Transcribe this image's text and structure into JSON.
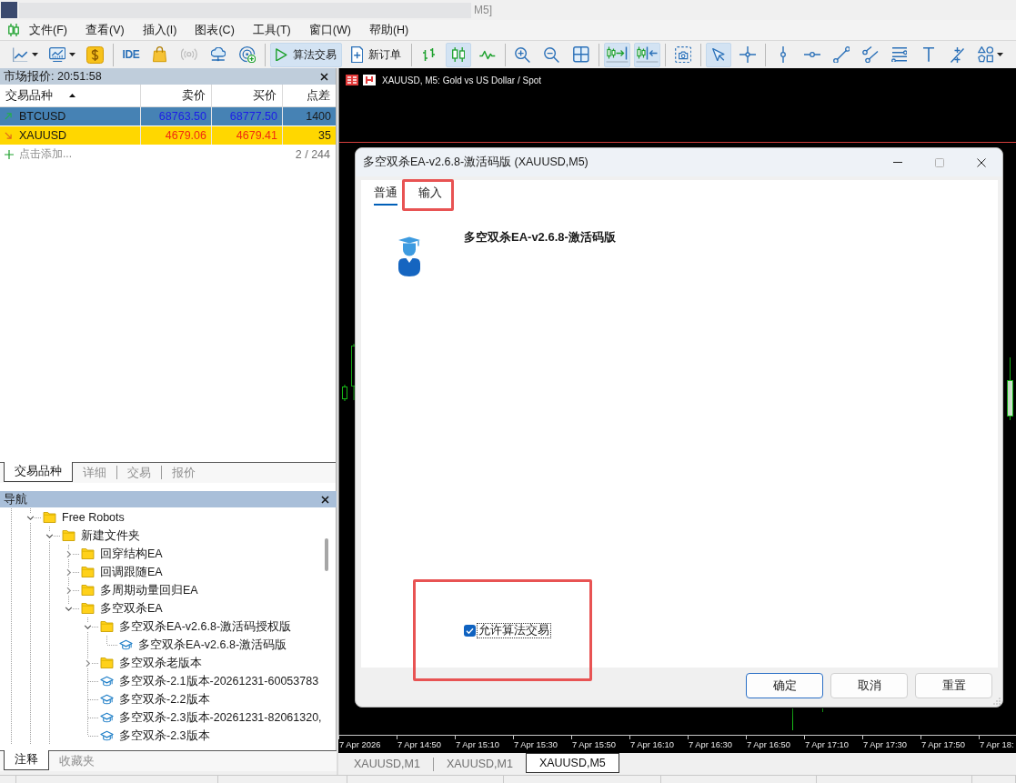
{
  "window": {
    "title": "M5]"
  },
  "menu": {
    "items": [
      "文件(F)",
      "查看(V)",
      "插入(I)",
      "图表(C)",
      "工具(T)",
      "窗口(W)",
      "帮助(H)"
    ]
  },
  "toolbar": {
    "groups": [
      [
        {
          "selected": false,
          "disabled": false
        },
        {
          "selected": false,
          "disabled": false
        },
        {
          "selected": false,
          "disabled": false
        }
      ],
      [
        {
          "label": "IDE",
          "selected": false,
          "disabled": false
        },
        {
          "selected": false,
          "disabled": false
        },
        {
          "selected": false,
          "disabled": true
        },
        {
          "selected": false,
          "disabled": false
        },
        {
          "selected": false,
          "disabled": false
        }
      ],
      [
        {
          "label": "算法交易",
          "selected": true,
          "disabled": false
        },
        {
          "label": "新订单",
          "selected": false,
          "disabled": false
        }
      ],
      [
        {
          "selected": false,
          "disabled": false
        },
        {
          "selected": true,
          "disabled": false
        },
        {
          "selected": false,
          "disabled": false
        }
      ],
      [
        {
          "selected": false,
          "disabled": false
        },
        {
          "selected": false,
          "disabled": false
        },
        {
          "selected": false,
          "disabled": false
        }
      ],
      [
        {
          "selected": true,
          "disabled": false
        },
        {
          "selected": true,
          "disabled": false
        }
      ],
      [
        {
          "selected": false,
          "disabled": false
        }
      ],
      [
        {
          "selected": true,
          "disabled": false
        },
        {
          "selected": false,
          "disabled": false
        }
      ],
      [
        {
          "selected": false,
          "disabled": false
        },
        {
          "selected": false,
          "disabled": false
        },
        {
          "selected": false,
          "disabled": false
        },
        {
          "selected": false,
          "disabled": false
        },
        {
          "selected": false,
          "disabled": false
        },
        {
          "selected": false,
          "disabled": false
        },
        {
          "selected": false,
          "disabled": false
        },
        {
          "selected": false,
          "disabled": false
        }
      ]
    ]
  },
  "market_watch": {
    "title": "市场报价: 20:51:58",
    "active": false,
    "columns": [
      {
        "label": "交易品种",
        "sorted": true
      },
      {
        "label": "卖价",
        "sorted": false
      },
      {
        "label": "买价",
        "sorted": false
      },
      {
        "label": "点差",
        "sorted": false
      }
    ],
    "rows": [
      {
        "symbol": "BTCUSD",
        "bid": "68763.50",
        "ask": "68777.50",
        "spread": "1400",
        "kind": "up",
        "color": "#4682b4"
      },
      {
        "symbol": "XAUUSD",
        "bid": "4679.06",
        "ask": "4679.41",
        "spread": "35",
        "kind": "down",
        "color": "#ffd700"
      }
    ],
    "add_label": "点击添加...",
    "count": "2 / 244",
    "tabs": [
      {
        "label": "交易品种",
        "selected": true
      },
      {
        "label": "详细",
        "selected": false
      },
      {
        "label": "交易",
        "selected": false
      },
      {
        "label": "报价",
        "selected": false
      }
    ]
  },
  "navigator": {
    "title": "导航",
    "active": true,
    "tree": [
      {
        "label": "Free Robots",
        "kind": "folder",
        "expanded": true,
        "children": [
          {
            "label": "新建文件夹",
            "kind": "folder",
            "expanded": true,
            "children": [
              {
                "label": "回穿结构EA",
                "kind": "folder",
                "expanded": false
              },
              {
                "label": "回调跟随EA",
                "kind": "folder",
                "expanded": false
              },
              {
                "label": "多周期动量回归EA",
                "kind": "folder",
                "expanded": false
              },
              {
                "label": "多空双杀EA",
                "kind": "folder",
                "expanded": true,
                "children": [
                  {
                    "label": "多空双杀EA-v2.6.8-激活码授权版",
                    "kind": "folder",
                    "expanded": true,
                    "children": [
                      {
                        "label": "多空双杀EA-v2.6.8-激活码版",
                        "kind": "expert"
                      }
                    ]
                  },
                  {
                    "label": "多空双杀老版本",
                    "kind": "folder",
                    "expanded": false
                  },
                  {
                    "label": "多空双杀-2.1版本-20261231-60053783",
                    "kind": "expert"
                  },
                  {
                    "label": "多空双杀-2.2版本",
                    "kind": "expert"
                  },
                  {
                    "label": "多空双杀-2.3版本-20261231-82061320,",
                    "kind": "expert"
                  },
                  {
                    "label": "多空双杀-2.3版本",
                    "kind": "expert"
                  }
                ]
              }
            ]
          }
        ]
      }
    ],
    "tabs": [
      {
        "label": "注释",
        "selected": true
      },
      {
        "label": "收藏夹",
        "selected": false
      }
    ]
  },
  "chart": {
    "title": "XAUUSD, M5: Gold vs US Dollar / Spot",
    "time_axis": [
      "7 Apr 2026",
      "7 Apr 14:50",
      "7 Apr 15:10",
      "7 Apr 15:30",
      "7 Apr 15:50",
      "7 Apr 16:10",
      "7 Apr 16:30",
      "7 Apr 16:50",
      "7 Apr 17:10",
      "7 Apr 17:30",
      "7 Apr 17:50",
      "7 Apr 18:"
    ],
    "tabs": [
      {
        "label": "XAUUSD,M1",
        "selected": false
      },
      {
        "label": "XAUUSD,M1",
        "selected": false
      },
      {
        "label": "XAUUSD,M5",
        "selected": true
      }
    ]
  },
  "dialog": {
    "title": "多空双杀EA-v2.6.8-激活码版 (XAUUSD,M5)",
    "controls": [
      {
        "kind": "minimize",
        "disabled": false
      },
      {
        "kind": "maximize",
        "disabled": true
      },
      {
        "kind": "close",
        "disabled": false
      }
    ],
    "tabs": [
      {
        "label": "普通",
        "selected": true,
        "highlighted": false
      },
      {
        "label": "输入",
        "selected": false,
        "highlighted": true
      }
    ],
    "expert_name": "多空双杀EA-v2.6.8-激活码版",
    "options": [
      {
        "label": "允许算法交易",
        "checked": true,
        "focused": true,
        "highlighted": true
      }
    ],
    "buttons": [
      {
        "label": "确定",
        "default": true
      },
      {
        "label": "取消",
        "default": false
      },
      {
        "label": "重置",
        "default": false
      }
    ]
  }
}
